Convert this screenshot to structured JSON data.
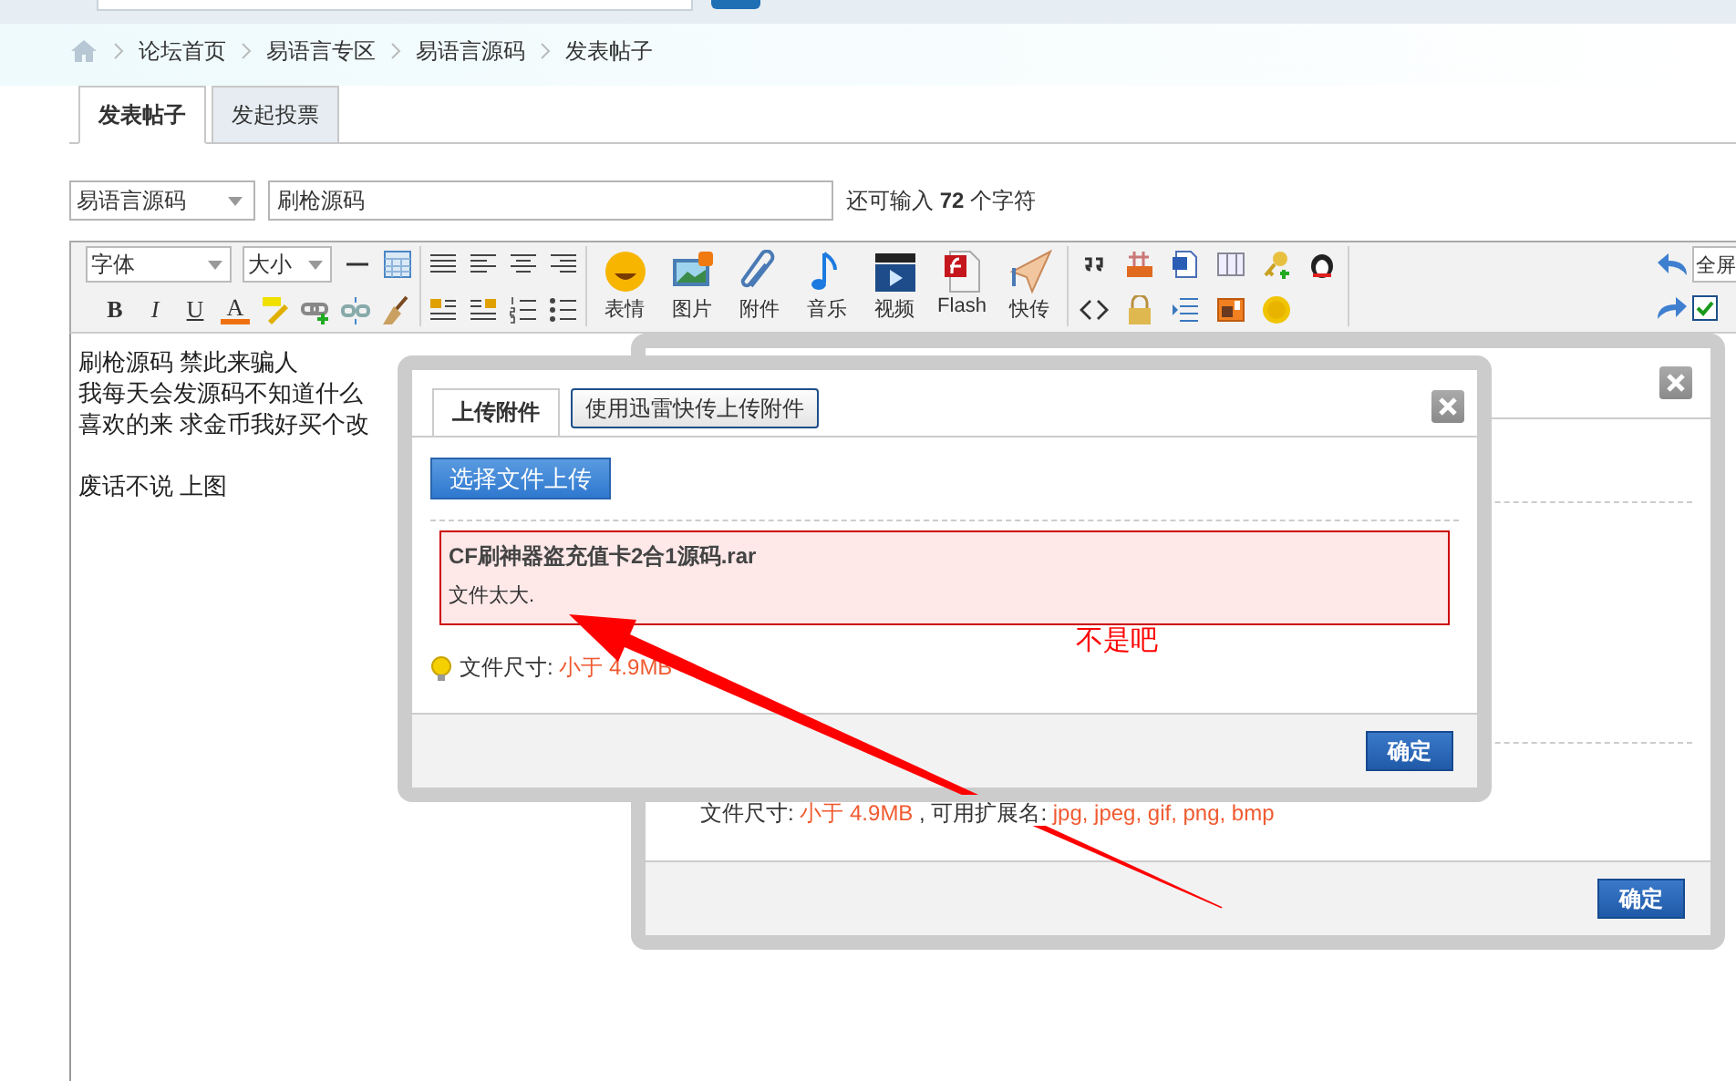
{
  "breadcrumb": [
    "论坛首页",
    "易语言专区",
    "易语言源码",
    "发表帖子"
  ],
  "tabs": [
    {
      "label": "发表帖子",
      "selected": true
    },
    {
      "label": "发起投票",
      "selected": false
    }
  ],
  "post_form": {
    "category": "易语言源码",
    "title": "刷枪源码",
    "count_prefix": "还可输入",
    "count": "72",
    "count_suffix": "个字符"
  },
  "toolbar": {
    "font_select": "字体",
    "size_select": "大小",
    "format_buttons": [
      "B",
      "I",
      "U",
      "A"
    ],
    "media_buttons": [
      {
        "label": "表情"
      },
      {
        "label": "图片"
      },
      {
        "label": "附件"
      },
      {
        "label": "音乐"
      },
      {
        "label": "视频"
      },
      {
        "label": "Flash"
      },
      {
        "label": "快传"
      }
    ],
    "fullscreen": "全屏",
    "checkbox": {
      "checked": true
    }
  },
  "editor_paragraphs": [
    {
      "lines": [
        "刷枪源码 禁此来骗人",
        "我每天会发源码不知道什么",
        "喜欢的来 求金币我好买个改"
      ]
    },
    {
      "lines": [
        "废话不说 上图"
      ]
    }
  ],
  "back_dialog": {
    "hint_label": "文件尺寸:",
    "size_limit": "小于 4.9MB",
    "ext_label": ", 可用扩展名:",
    "extensions": "jpg, jpeg, gif, png, bmp",
    "confirm": "确定"
  },
  "upload_dialog": {
    "tabs": [
      {
        "label": "上传附件",
        "selected": true
      },
      {
        "label": "使用迅雷快传上传附件",
        "selected": false
      }
    ],
    "choose_button": "选择文件上传",
    "error": {
      "filename": "CF刷神器盗充值卡2合1源码.rar",
      "message": "文件太大."
    },
    "hint_label": "文件尺寸:",
    "size_limit": "小于 4.9MB",
    "confirm": "确定"
  },
  "annotation": {
    "text": "不是吧"
  }
}
